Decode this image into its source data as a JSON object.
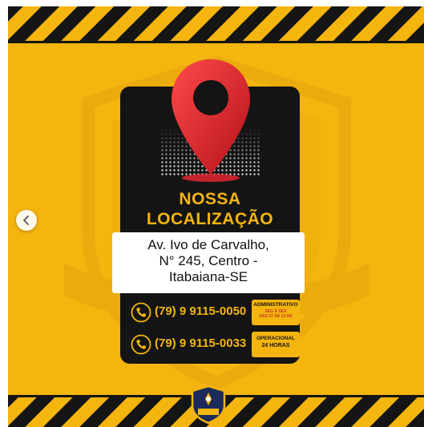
{
  "post": {
    "headline": [
      "NOSSA",
      "LOCALIZAÇÃO"
    ],
    "address": [
      "Av. Ivo de Carvalho,",
      "N° 245,  Centro -",
      "Itabaiana-SE"
    ],
    "contacts": [
      {
        "phone": "(79) 9 9115-0050",
        "tag_title": "ADMINISTRATIVO",
        "tag_line1": "SEG À SEX",
        "tag_line2": "DAS 07 ÀS 12 HS"
      },
      {
        "phone": "(79) 9 9115-0033",
        "tag_title": "OPERACIONAL",
        "tag_line1": "24 HORAS"
      }
    ],
    "colors": {
      "brand_yellow": "#f5b50f",
      "dark": "#141414",
      "pin_red": "#e3262f"
    },
    "icons": {
      "pin": "location-pin-icon",
      "phone": "phone-icon",
      "badge": "security-shield-badge",
      "prev": "chevron-left-icon"
    }
  }
}
